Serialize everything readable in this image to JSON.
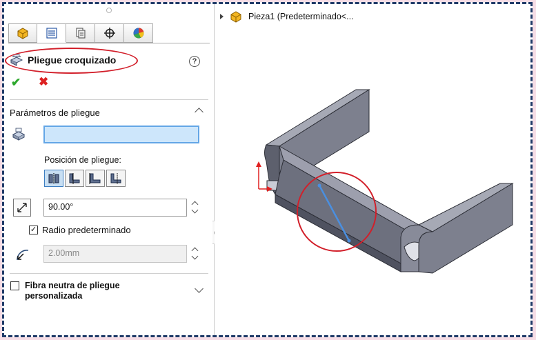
{
  "feature_panel": {
    "title": "Pliegue croquizado",
    "help_glyph": "?",
    "ok_glyph": "✔",
    "cancel_glyph": "✖",
    "tabs": [
      {
        "name": "featuremanager-tab",
        "icon": "part-icon"
      },
      {
        "name": "propertymanager-tab",
        "icon": "property-manager-icon"
      },
      {
        "name": "configurationmanager-tab",
        "icon": "configuration-icon"
      },
      {
        "name": "dimxpert-tab",
        "icon": "dimxpert-icon"
      },
      {
        "name": "display-manager-tab",
        "icon": "appearance-icon"
      }
    ],
    "bend_parameters": {
      "header": "Parámetros de pliegue",
      "fixed_face_value": "",
      "bend_position_label": "Posición de pliegue:",
      "bend_position_options": [
        "line-center",
        "material-inside",
        "material-outside",
        "bend-outside"
      ],
      "angle_value": "90.00°",
      "default_radius_label": "Radio predeterminado",
      "default_radius_checked": true,
      "radius_value": "2.00mm"
    },
    "custom_neutral_fiber": {
      "label": "Fibra neutra de pliegue personalizada",
      "checked": false
    }
  },
  "feature_tree": {
    "item_label": "Pieza1  (Predeterminado<..."
  },
  "colors": {
    "highlight_oval": "#d21f2a",
    "sheet_metal_part": "#6f7180",
    "sketch_line": "#4a8fe0",
    "frame_border": "#1f3a68"
  }
}
